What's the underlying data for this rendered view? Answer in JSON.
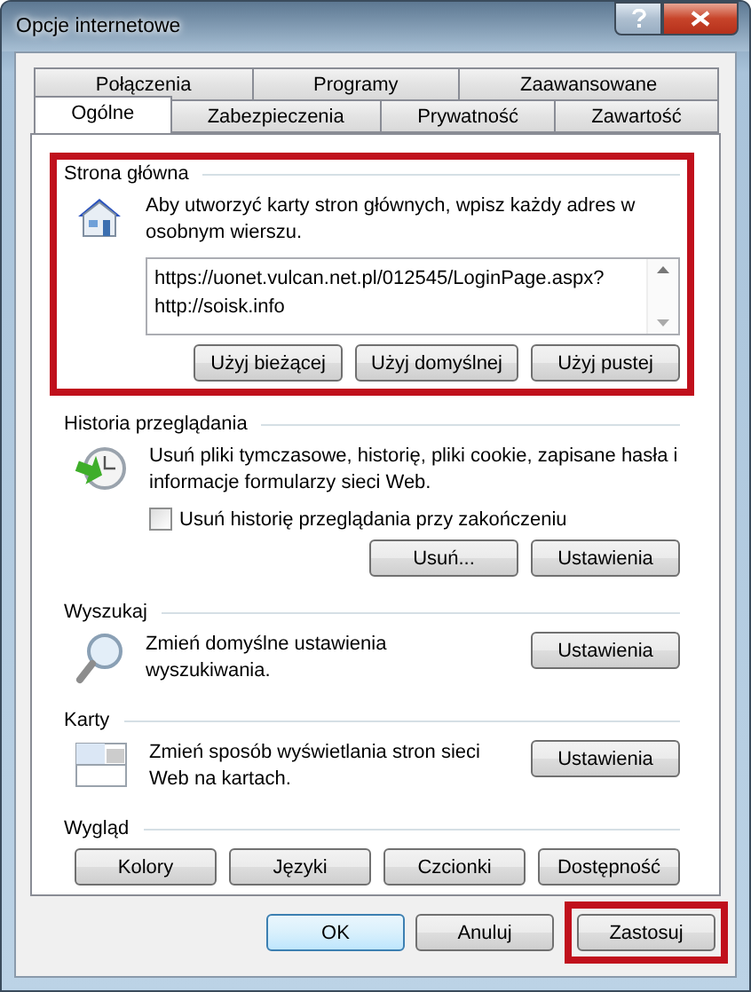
{
  "window": {
    "title": "Opcje internetowe"
  },
  "tab_rows": [
    [
      {
        "label": "Połączenia",
        "selected": false
      },
      {
        "label": "Programy",
        "selected": false
      },
      {
        "label": "Zaawansowane",
        "selected": false
      }
    ],
    [
      {
        "label": "Ogólne",
        "selected": true
      },
      {
        "label": "Zabezpieczenia",
        "selected": false
      },
      {
        "label": "Prywatność",
        "selected": false
      },
      {
        "label": "Zawartość",
        "selected": false
      }
    ]
  ],
  "sections": [
    {
      "kind": "home",
      "title": "Strona główna",
      "highlighted": true,
      "description": "Aby utworzyć karty stron głównych, wpisz każdy adres w osobnym wierszu.",
      "urls": [
        "https://uonet.vulcan.net.pl/012545/LoginPage.aspx?",
        "http://soisk.info"
      ],
      "buttons": [
        "Użyj bieżącej",
        "Użyj domyślnej",
        "Użyj pustej"
      ]
    },
    {
      "kind": "history",
      "title": "Historia przeglądania",
      "highlighted": false,
      "description": "Usuń pliki tymczasowe, historię, pliki cookie, zapisane hasła i informacje formularzy sieci Web.",
      "checkbox": {
        "label": "Usuń historię przeglądania przy zakończeniu",
        "checked": false
      },
      "buttons": [
        "Usuń...",
        "Ustawienia"
      ]
    },
    {
      "kind": "search",
      "title": "Wyszukaj",
      "highlighted": false,
      "description": "Zmień domyślne ustawienia wyszukiwania.",
      "buttons": [
        "Ustawienia"
      ]
    },
    {
      "kind": "tabs",
      "title": "Karty",
      "highlighted": false,
      "description": "Zmień sposób wyświetlania stron sieci Web na kartach.",
      "buttons": [
        "Ustawienia"
      ]
    },
    {
      "kind": "appearance",
      "title": "Wygląd",
      "highlighted": false,
      "buttons": [
        "Kolory",
        "Języki",
        "Czcionki",
        "Dostępność"
      ]
    }
  ],
  "footer_buttons": [
    {
      "label": "OK",
      "default": true,
      "highlighted": false
    },
    {
      "label": "Anuluj",
      "default": false,
      "highlighted": false
    },
    {
      "label": "Zastosuj",
      "default": false,
      "highlighted": true
    }
  ]
}
